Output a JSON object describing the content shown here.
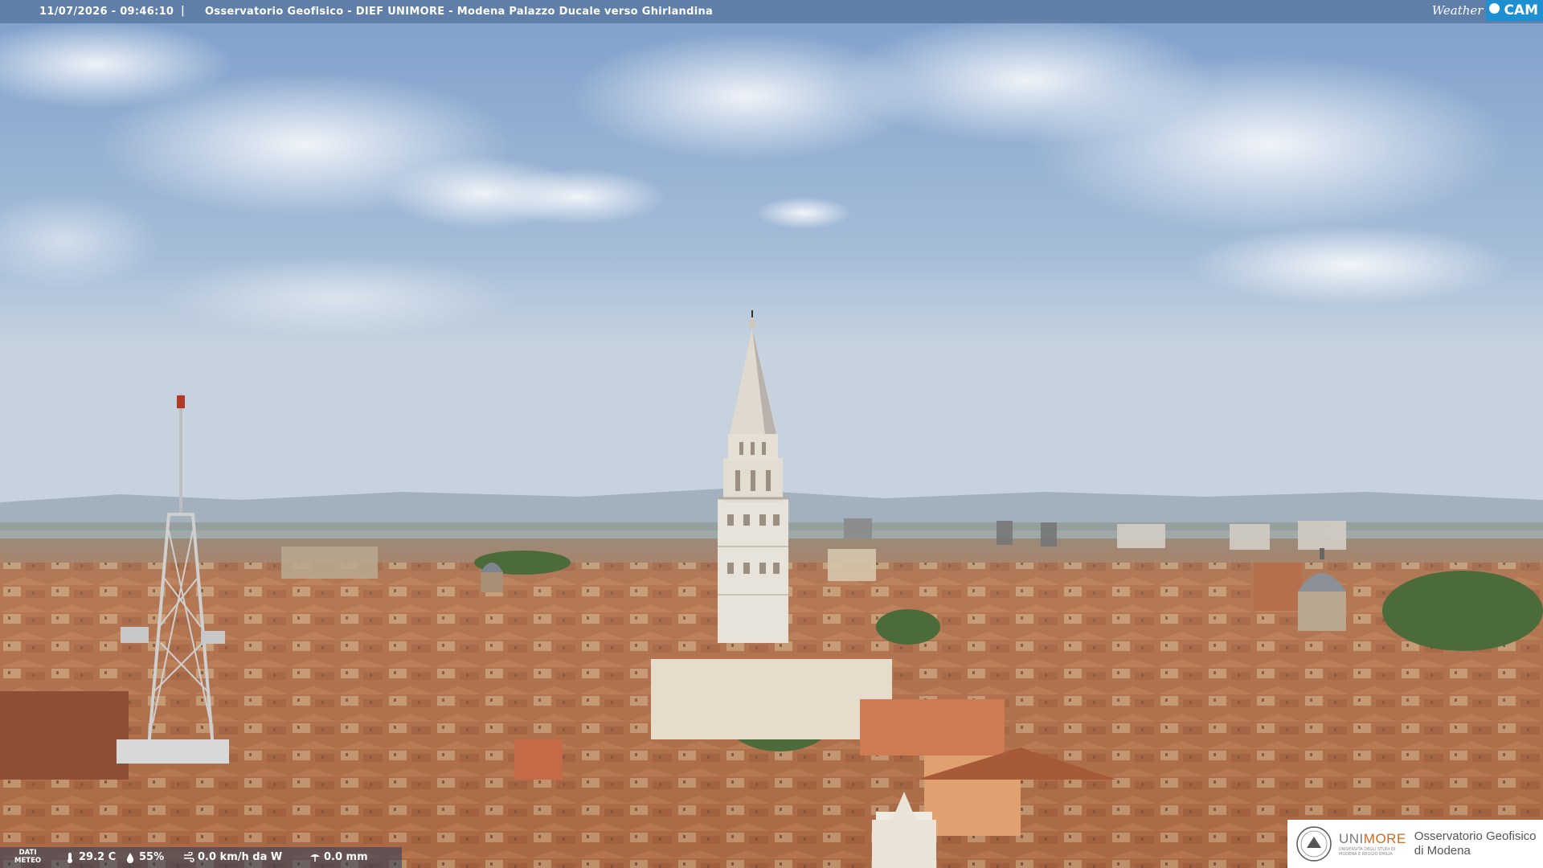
{
  "header": {
    "datetime": "11/07/2026 - 09:46:10",
    "separator": "|",
    "title": "Osservatorio Geofisico - DIEF UNIMORE - Modena Palazzo Ducale verso Ghirlandina"
  },
  "brand_logo": {
    "weather": "Weather",
    "cam": "CAM"
  },
  "meteo": {
    "label_line1": "DATI",
    "label_line2": "METEO",
    "temperature": "29.2 C",
    "humidity": "55%",
    "wind": "0.0 km/h da W",
    "rain": "0.0 mm",
    "icons": [
      "thermometer-icon",
      "drop-icon",
      "wind-icon",
      "rain-icon"
    ]
  },
  "institution": {
    "name_a": "UNI",
    "name_b": "MORE",
    "subtitle1": "UNIVERSITÀ DEGLI STUDI DI",
    "subtitle2": "MODENA E REGGIO EMILIA",
    "observatory_line1": "Osservatorio Geofisico",
    "observatory_line2": "di Modena"
  },
  "colors": {
    "sky_top": "#7e9fcb",
    "sky_bottom": "#c9d6e2",
    "roof": "#b8774f",
    "tower": "#e8e3da",
    "accent_orange": "#d2691e",
    "weathercam_blue": "#1e8fd0"
  }
}
